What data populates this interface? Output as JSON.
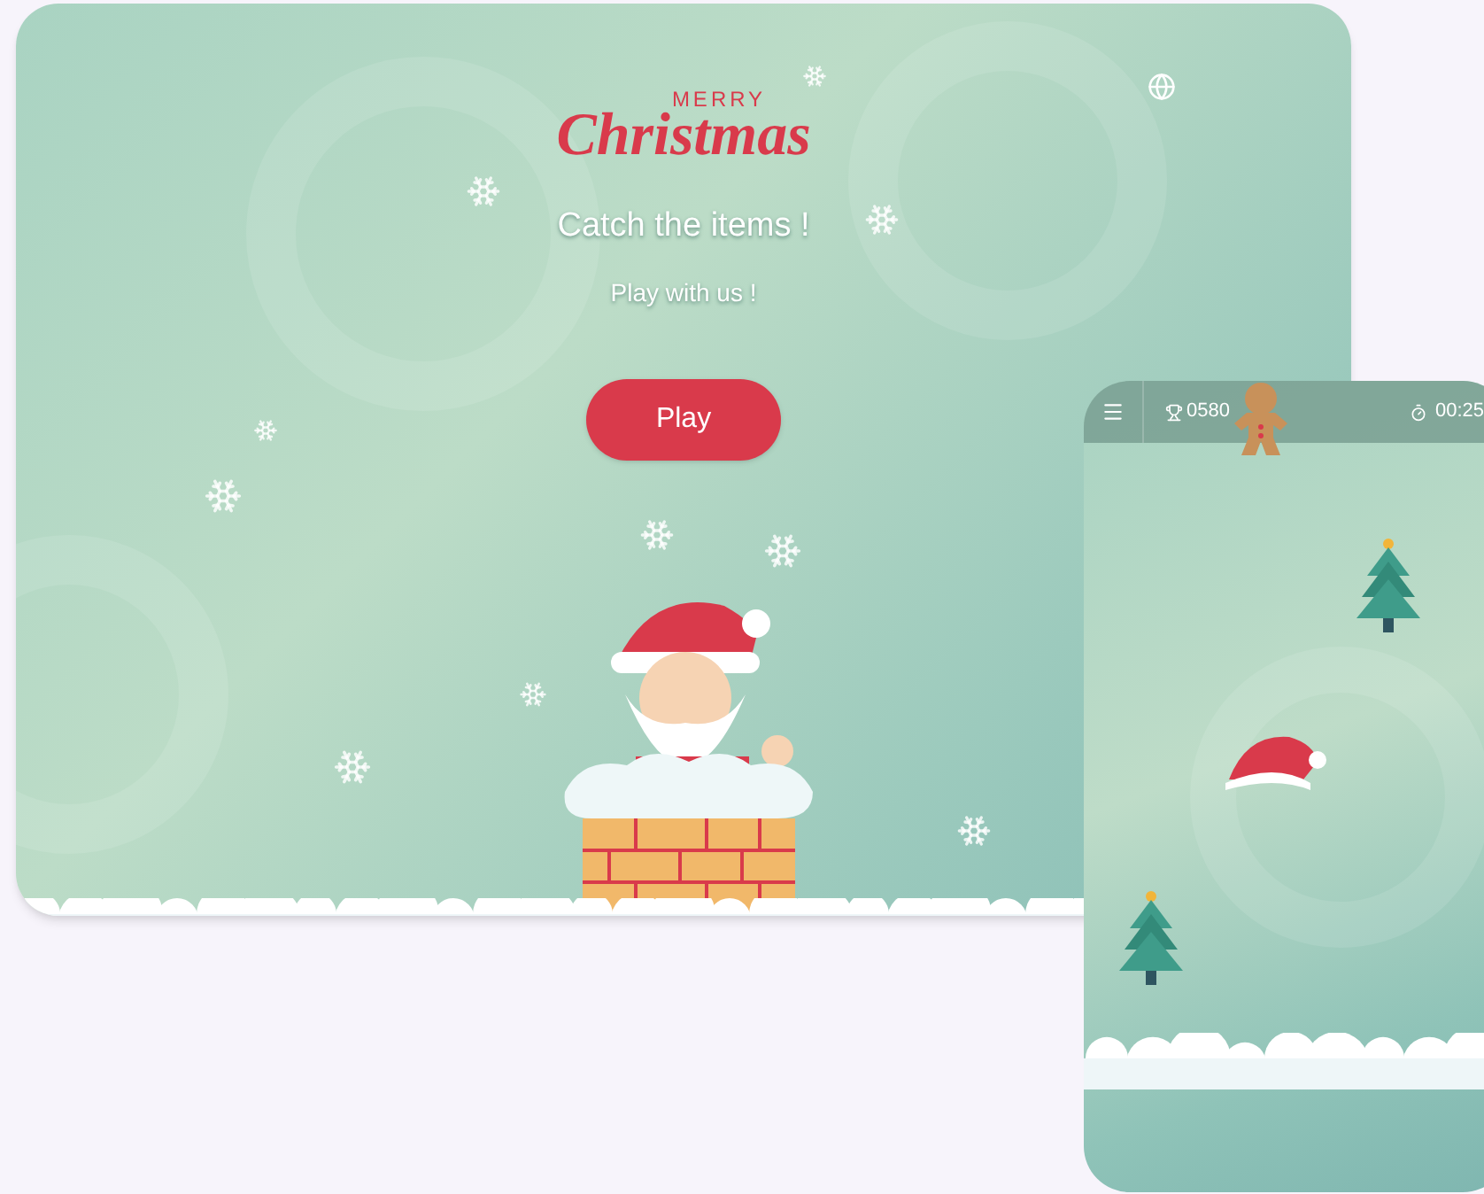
{
  "tablet": {
    "logo": {
      "top": "MERRY",
      "script": "Christmas"
    },
    "title": "Catch the items !",
    "subtitle": "Play with us !",
    "play_button": "Play"
  },
  "phone": {
    "hud": {
      "score": "0580",
      "time": "00:25"
    }
  }
}
